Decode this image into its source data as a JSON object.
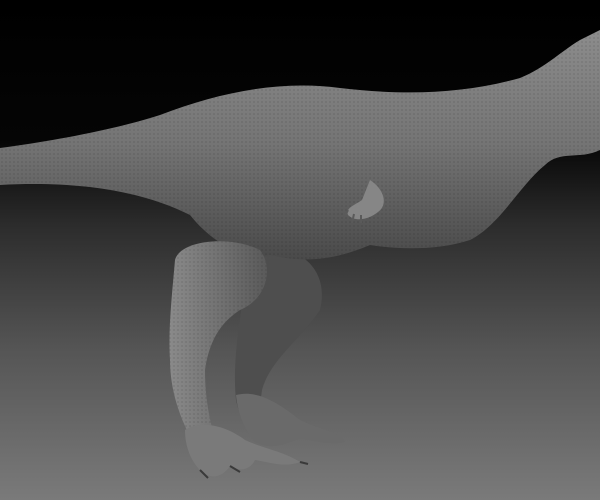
{
  "scene": {
    "subject": "dinosaur-sculpt",
    "colors": {
      "background_top": "#000000",
      "background_bottom": "#7a7a7a",
      "skin_light": "#8a8a8a",
      "skin_mid": "#6f6f6f",
      "skin_dark": "#3e3e3e"
    }
  }
}
